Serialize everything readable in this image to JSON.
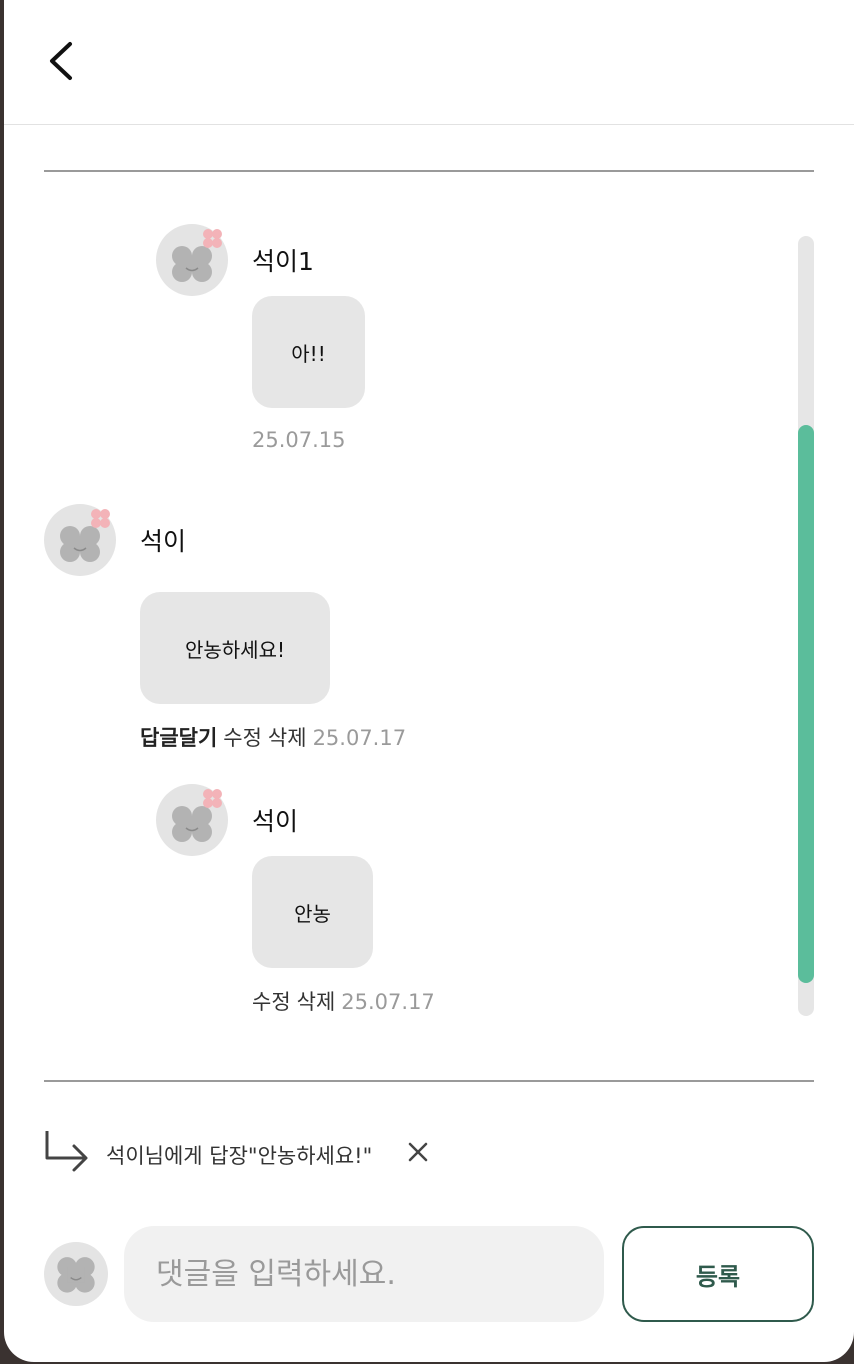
{
  "comments": [
    {
      "name": "석이1",
      "text": "아!!",
      "date": "25.07.15"
    },
    {
      "name": "석이",
      "text": "안농하세요!",
      "reply_label": "답글달기",
      "edit_label": "수정",
      "delete_label": "삭제",
      "date": "25.07.17"
    },
    {
      "name": "석이",
      "text": "안농",
      "edit_label": "수정",
      "delete_label": "삭제",
      "date": "25.07.17"
    }
  ],
  "reply_bar": {
    "text": "석이님에게 답장\"안농하세요!\""
  },
  "composer": {
    "placeholder": "댓글을 입력하세요.",
    "submit_label": "등록"
  },
  "colors": {
    "accent": "#5bbd9b",
    "button_border": "#2f5a4c",
    "bubble": "#e6e6e6"
  },
  "icons": {
    "back": "chevron-left-icon",
    "reply": "reply-arrow-icon",
    "close": "close-icon",
    "avatar": "clover-avatar-icon"
  }
}
